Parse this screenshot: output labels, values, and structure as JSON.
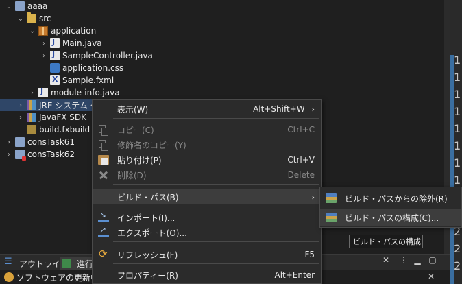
{
  "tree": [
    {
      "indent": 0,
      "twisty": "down",
      "icon": "project",
      "label": "aaaa"
    },
    {
      "indent": 1,
      "twisty": "down",
      "icon": "folder",
      "label": "src"
    },
    {
      "indent": 2,
      "twisty": "down",
      "icon": "package",
      "label": "application"
    },
    {
      "indent": 3,
      "twisty": "right",
      "icon": "java",
      "label": "Main.java"
    },
    {
      "indent": 3,
      "twisty": "right",
      "icon": "java",
      "label": "SampleController.java"
    },
    {
      "indent": 3,
      "twisty": "none",
      "icon": "css",
      "label": "application.css"
    },
    {
      "indent": 3,
      "twisty": "none",
      "icon": "fxml",
      "label": "Sample.fxml"
    },
    {
      "indent": 2,
      "twisty": "right",
      "icon": "java",
      "label": "module-info.java"
    },
    {
      "indent": 1,
      "twisty": "right",
      "icon": "library",
      "label": "JRE システム・ライ",
      "selected": true
    },
    {
      "indent": 1,
      "twisty": "right",
      "icon": "library",
      "label": "JavaFX SDK"
    },
    {
      "indent": 1,
      "twisty": "none",
      "icon": "build",
      "label": "build.fxbuild"
    },
    {
      "indent": 0,
      "twisty": "right",
      "icon": "project",
      "label": "consTask61"
    },
    {
      "indent": 0,
      "twisty": "right",
      "icon": "project-error",
      "label": "consTask62"
    }
  ],
  "gutter_numbers": [
    "1",
    "1",
    "1",
    "1",
    "1",
    "1",
    "1",
    "1",
    "2",
    "2",
    "2",
    "2",
    "2"
  ],
  "menu": {
    "items": [
      {
        "label": "表示(W)",
        "accel": "Alt+Shift+W",
        "submenu": true,
        "icon": ""
      },
      {
        "label": "コピー(C)",
        "accel": "Ctrl+C",
        "disabled": true,
        "icon": "copy-icon"
      },
      {
        "label": "修飾名のコピー(Y)",
        "accel": "",
        "disabled": true,
        "icon": "copy-qualified-icon"
      },
      {
        "label": "貼り付け(P)",
        "accel": "Ctrl+V",
        "icon": "paste-icon"
      },
      {
        "label": "削除(D)",
        "accel": "Delete",
        "disabled": true,
        "icon": "delete-icon"
      },
      {
        "label": "ビルド・パス(B)",
        "accel": "",
        "submenu": true,
        "highlighted": true,
        "icon": ""
      },
      {
        "label": "インポート(I)...",
        "accel": "",
        "icon": "import-icon"
      },
      {
        "label": "エクスポート(O)...",
        "accel": "",
        "icon": "export-icon"
      },
      {
        "label": "リフレッシュ(F)",
        "accel": "F5",
        "icon": "refresh-icon"
      },
      {
        "label": "プロパティー(R)",
        "accel": "Alt+Enter",
        "icon": ""
      }
    ]
  },
  "submenu": {
    "items": [
      {
        "label": "ビルド・パスからの除外(R)",
        "icon": "build-path-exclude-icon"
      },
      {
        "label": "ビルド・パスの構成(C)...",
        "icon": "build-path-configure-icon",
        "highlighted": true
      }
    ]
  },
  "tooltip": "ビルド・パスの構成",
  "bottom_tabs": [
    {
      "label": "アウトライン",
      "icon": "outline-icon"
    },
    {
      "label": "進行",
      "icon": "progress-icon",
      "active": true
    }
  ],
  "progress_text": "ソフトウェアの更新中（"
}
